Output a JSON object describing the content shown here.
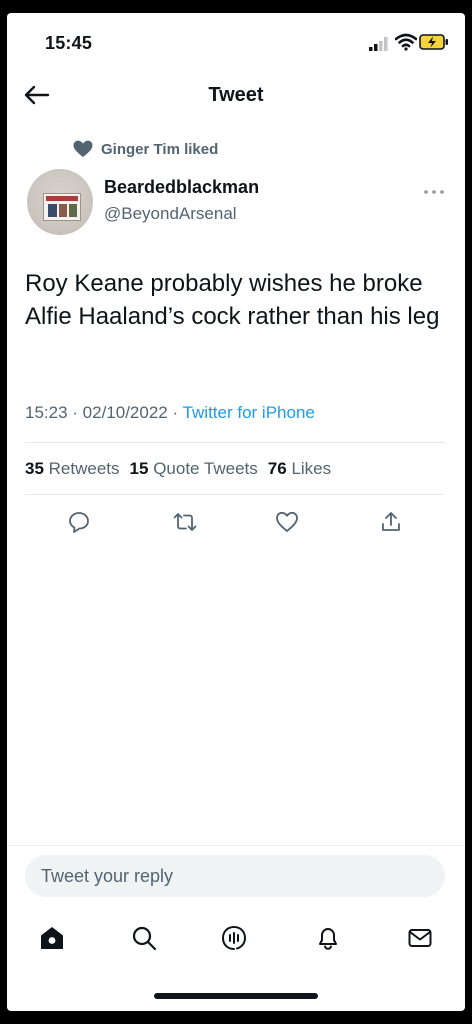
{
  "status_bar": {
    "time": "15:45"
  },
  "header": {
    "title": "Tweet"
  },
  "social_context": {
    "text": "Ginger Tim liked"
  },
  "author": {
    "display_name": "Beardedblackman",
    "handle": "@BeyondArsenal"
  },
  "tweet": {
    "text": "Roy Keane probably wishes he broke Alfie Haaland’s cock rather than his leg",
    "time": "15:23",
    "date": "02/10/2022",
    "source": "Twitter for iPhone"
  },
  "stats": {
    "retweets_count": "35",
    "retweets_label": "Retweets",
    "quotes_count": "15",
    "quotes_label": "Quote Tweets",
    "likes_count": "76",
    "likes_label": "Likes"
  },
  "reply": {
    "placeholder": "Tweet your reply"
  },
  "icons": {
    "back": "back-arrow-icon",
    "more": "more-icon",
    "liked": "heart-filled-icon",
    "actions": [
      "reply-icon",
      "retweet-icon",
      "like-icon",
      "share-icon"
    ],
    "nav": [
      "home-icon",
      "search-icon",
      "spaces-icon",
      "notifications-icon",
      "messages-icon"
    ]
  },
  "colors": {
    "accent": "#1d9bf0",
    "secondary_text": "#536471",
    "liked_heart": "#536471"
  }
}
